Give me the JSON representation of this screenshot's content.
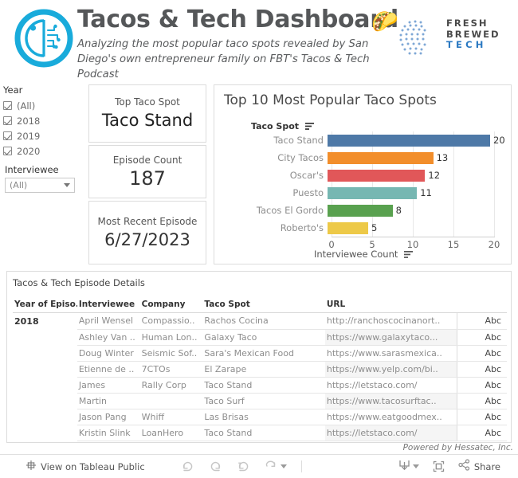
{
  "header": {
    "title": "Tacos & Tech Dashboard",
    "subtitle": "Analyzing the most popular taco spots revealed by San Diego's own entrepreneur family on FBT's Tacos & Tech Podcast",
    "taco_emoji": "🌮",
    "logo_name": "brain-circuit-logo",
    "partner_logo": {
      "line1": "FRESH",
      "line2": "BREWED",
      "line3": "TECH",
      "color": "#2b79c2"
    }
  },
  "filters": {
    "year": {
      "label": "Year",
      "options": [
        {
          "label": "(All)",
          "checked": true
        },
        {
          "label": "2018",
          "checked": true
        },
        {
          "label": "2019",
          "checked": true
        },
        {
          "label": "2020",
          "checked": true
        }
      ]
    },
    "interviewee": {
      "label": "Interviewee",
      "value": "(All)"
    }
  },
  "kpis": [
    {
      "label": "Top Taco Spot",
      "value": "Taco Stand"
    },
    {
      "label": "Episode Count",
      "value": "187"
    },
    {
      "label": "Most Recent Episode",
      "value": "6/27/2023"
    }
  ],
  "chart_data": {
    "type": "bar",
    "title": "Top 10 Most Popular Taco Spots",
    "orientation": "horizontal",
    "categories": [
      "Taco Stand",
      "City Tacos",
      "Oscar's",
      "Puesto",
      "Tacos El Gordo",
      "Roberto's"
    ],
    "values": [
      20,
      13,
      12,
      11,
      8,
      5
    ],
    "colors": [
      "#4e79a7",
      "#f28e2b",
      "#e15759",
      "#76b7b2",
      "#59a14f",
      "#edc948"
    ],
    "xlabel": "Interviewee Count",
    "ylabel": "Taco Spot",
    "xlim": [
      0,
      24
    ],
    "xticks": [
      "0",
      "5",
      "10",
      "15",
      "20"
    ],
    "grid": true,
    "legend": "none",
    "note": "list is clipped at bottom; 6 of 10 bars visible"
  },
  "table": {
    "title": "Tacos & Tech Episode Details",
    "columns": [
      "Year of Episo..",
      "Interviewee",
      "Company",
      "Taco Spot",
      "URL",
      ""
    ],
    "rows": [
      {
        "year": "2018",
        "interviewee": "April Wensel",
        "company": "Compassio..",
        "spot": "Rachos Cocina",
        "url": "http://ranchoscocinanort..",
        "abc": "Abc"
      },
      {
        "year": "",
        "interviewee": "Ashley Van ..",
        "company": "Human Lon..",
        "spot": "Galaxy Taco",
        "url": "https://www.galaxytaco...",
        "abc": "Abc"
      },
      {
        "year": "",
        "interviewee": "Doug Winter",
        "company": "Seismic Sof..",
        "spot": "Sara's Mexican Food",
        "url": "https://www.sarasmexica..",
        "abc": "Abc"
      },
      {
        "year": "",
        "interviewee": "Etienne de ..",
        "company": "7CTOs",
        "spot": "El Zarape",
        "url": "https://www.yelp.com/bi..",
        "abc": "Abc"
      },
      {
        "year": "",
        "interviewee": "James",
        "company": "Rally Corp",
        "spot": "Taco Stand",
        "url": "https://letstaco.com/",
        "abc": "Abc"
      },
      {
        "year": "",
        "interviewee": "Martin",
        "company": "",
        "spot": "Taco Surf",
        "url": "https://www.tacosurftac..",
        "abc": "Abc"
      },
      {
        "year": "",
        "interviewee": "Jason Pang",
        "company": "Whiff",
        "spot": "Las Brisas",
        "url": "https://www.eatgoodmex..",
        "abc": "Abc"
      },
      {
        "year": "",
        "interviewee": "Kristin Slink",
        "company": "LoanHero",
        "spot": "Taco Stand",
        "url": "https://letstaco.com/",
        "abc": "Abc"
      }
    ]
  },
  "footer": {
    "powered_by": "Powered by Hessatec, Inc.",
    "tableau_label": "View on Tableau Public",
    "share_label": "Share"
  }
}
